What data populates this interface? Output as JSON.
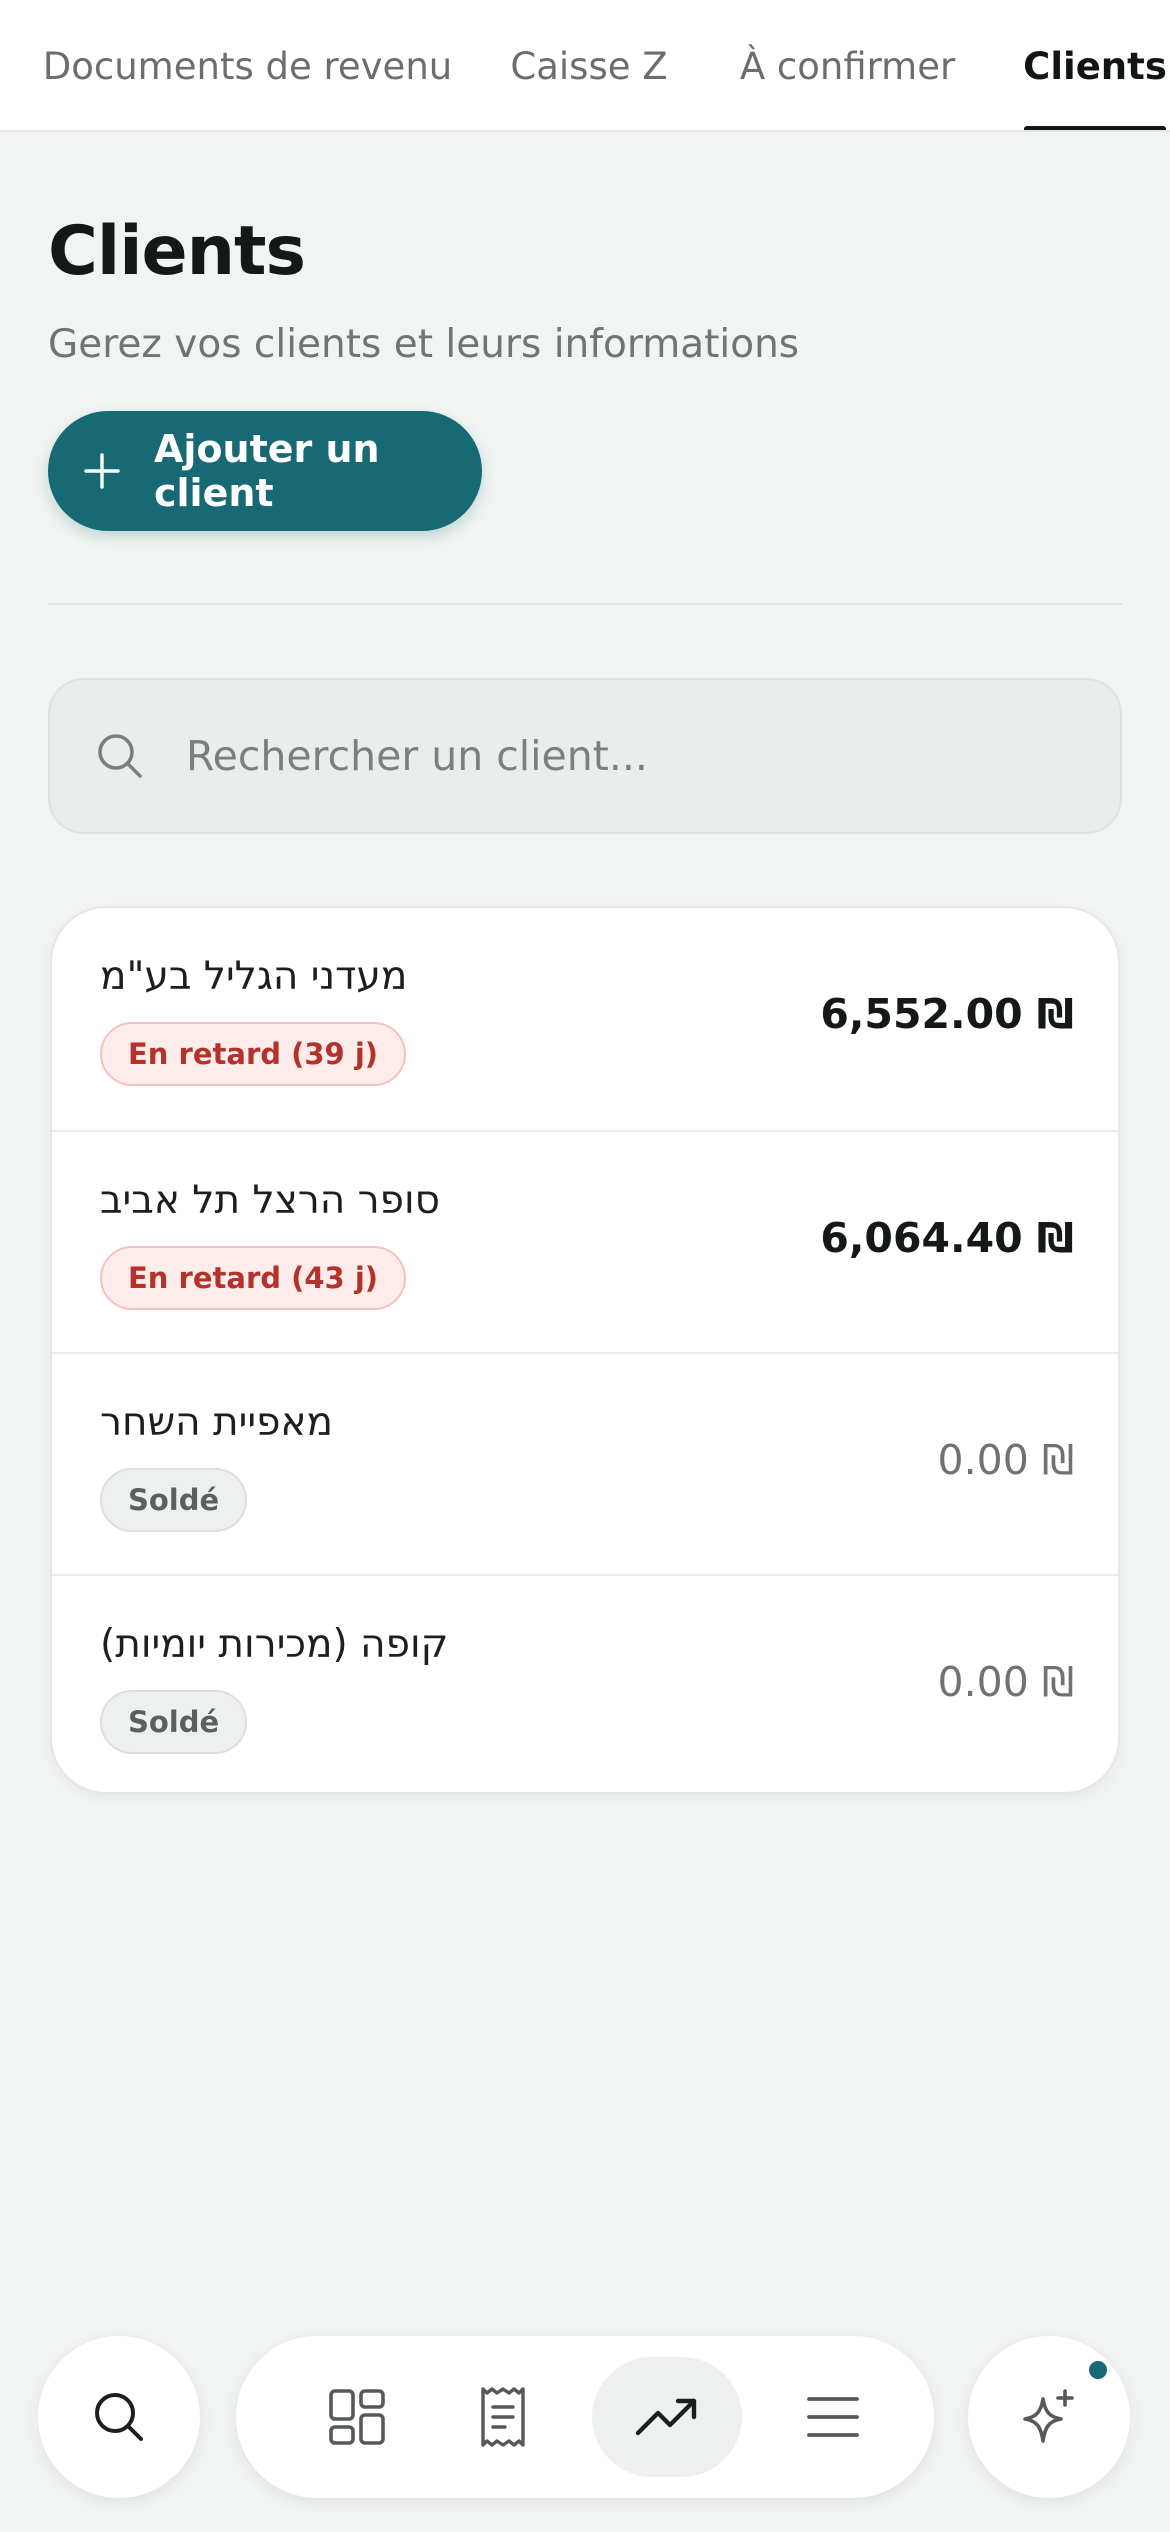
{
  "tabs": [
    {
      "label": "Documents de revenu",
      "active": false
    },
    {
      "label": "Caisse Z",
      "active": false
    },
    {
      "label": "À confirmer",
      "active": false
    },
    {
      "label": "Clients",
      "active": true
    }
  ],
  "header": {
    "title": "Clients",
    "subtitle": "Gerez vos clients et leurs informations",
    "add_button_label": "Ajouter un client",
    "add_button_icon": "plus-icon"
  },
  "search": {
    "placeholder": "Rechercher un client...",
    "value": "",
    "icon": "search-icon"
  },
  "clients": [
    {
      "name": "מעדני הגליל בע\"מ",
      "status": "En retard (39 j)",
      "status_type": "overdue",
      "amount": "6,552.00 ₪"
    },
    {
      "name": "סופר הרצל תל אביב",
      "status": "En retard (43 j)",
      "status_type": "overdue",
      "amount": "6,064.40 ₪"
    },
    {
      "name": "מאפיית השחר",
      "status": "Soldé",
      "status_type": "paid",
      "amount": "0.00 ₪"
    },
    {
      "name": "קופה (מכירות יומיות)",
      "status": "Soldé",
      "status_type": "paid",
      "amount": "0.00 ₪"
    }
  ],
  "bottom_nav": {
    "items": [
      "search-icon",
      "dashboard-icon",
      "receipt-icon",
      "trending-up-icon",
      "menu-icon",
      "sparkles-icon"
    ],
    "active": "trending-up-icon"
  },
  "colors": {
    "accent": "#176a73",
    "overdue_text": "#b3322a",
    "overdue_bg": "#fdecea",
    "background": "#f1f4f2"
  }
}
